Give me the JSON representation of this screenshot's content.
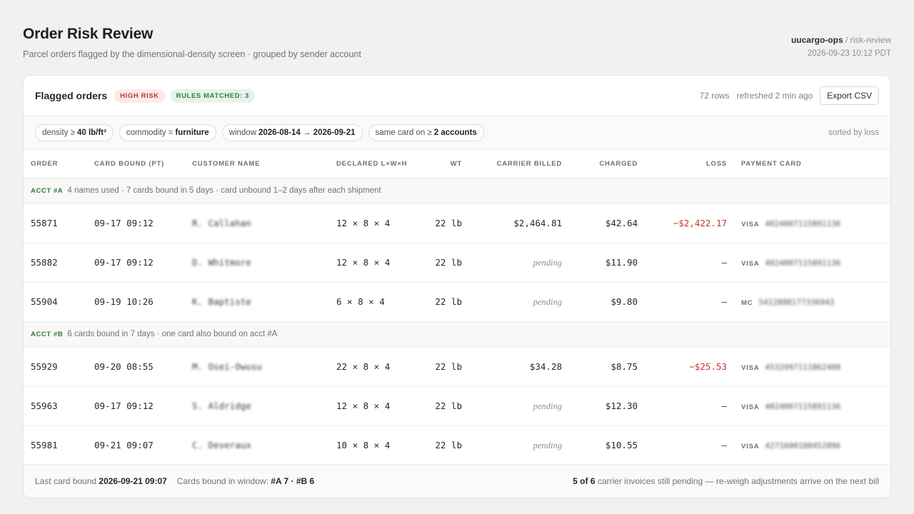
{
  "header": {
    "title": "Order Risk Review",
    "subtitle": "Parcel orders flagged by the dimensional-density screen · grouped by sender account",
    "org": "uucargo-ops",
    "separator": " / ",
    "section": "risk-review",
    "timestamp": "2026-09-23 10:12 PDT"
  },
  "card": {
    "title": "Flagged orders",
    "badge_risk": "HIGH RISK",
    "badge_rules": "RULES MATCHED: 3",
    "rows_count": "72 rows",
    "refreshed": "refreshed 2 min ago",
    "export_label": "Export CSV"
  },
  "filters": {
    "chips": [
      {
        "label": "density ≥",
        "value": "40 lb/ft³"
      },
      {
        "label": "commodity =",
        "value": "furniture"
      },
      {
        "label": "window",
        "value": "2026-08-14 → 2026-09-21"
      },
      {
        "label": "same card on ≥",
        "value": "2 accounts"
      }
    ],
    "sorted": "sorted by loss"
  },
  "table": {
    "columns": [
      "ORDER",
      "CARD BOUND (PT)",
      "CUSTOMER NAME",
      "DECLARED L×W×H",
      "WT",
      "CARRIER BILLED",
      "CHARGED",
      "LOSS",
      "PAYMENT CARD"
    ],
    "groups": [
      {
        "tag": "ACCT #A",
        "note": "4 names used · 7 cards bound in 5 days · card unbound 1–2 days after each shipment",
        "rows": [
          {
            "order": "55871",
            "bound": "09-17 09:12",
            "name": "R. Callahan",
            "dims": "12 × 8 × 4",
            "wt": "22 lb",
            "billed": "$2,464.81",
            "charged": "$42.64",
            "loss": "−$2,422.17",
            "brand": "VISA",
            "card": "4024007115891136"
          },
          {
            "order": "55882",
            "bound": "09-17 09:12",
            "name": "D. Whitmore",
            "dims": "12 × 8 × 4",
            "wt": "22 lb",
            "billed": "pending",
            "charged": "$11.90",
            "loss": "—",
            "brand": "VISA",
            "card": "4024007115891136"
          },
          {
            "order": "55904",
            "bound": "09-19 10:26",
            "name": "K. Baptiste",
            "dims": "6 × 8 × 4",
            "wt": "22 lb",
            "billed": "pending",
            "charged": "$9.80",
            "loss": "—",
            "brand": "MC",
            "card": "5412888177336943"
          }
        ]
      },
      {
        "tag": "ACCT #B",
        "note": "6 cards bound in 7 days · one card also bound on acct #A",
        "rows": [
          {
            "order": "55929",
            "bound": "09-20 08:55",
            "name": "M. Osei-Owusu",
            "dims": "22 × 8 × 4",
            "wt": "22 lb",
            "billed": "$34.28",
            "charged": "$8.75",
            "loss": "−$25.53",
            "brand": "VISA",
            "card": "4532997111862408"
          },
          {
            "order": "55963",
            "bound": "09-17 09:12",
            "name": "S. Aldridge",
            "dims": "12 × 8 × 4",
            "wt": "22 lb",
            "billed": "pending",
            "charged": "$12.30",
            "loss": "—",
            "brand": "VISA",
            "card": "4024007115891136"
          },
          {
            "order": "55981",
            "bound": "09-21 09:07",
            "name": "C. Deveraux",
            "dims": "10 × 8 × 4",
            "wt": "22 lb",
            "billed": "pending",
            "charged": "$10.55",
            "loss": "—",
            "brand": "VISA",
            "card": "4271600188452896"
          }
        ]
      }
    ]
  },
  "footer": {
    "last_bound_label": "Last card bound",
    "last_bound_value": "2026-09-21 09:07",
    "cards_label": "Cards bound in window:",
    "cards_value": "#A 7 · #B 6",
    "pending_value": "5 of 6",
    "pending_text": "carrier invoices still pending — re-weigh adjustments arrive on the next bill"
  },
  "colors": {
    "accent_red": "#c2372f",
    "accent_green": "#2f7a45",
    "background": "#f1f1ef"
  }
}
